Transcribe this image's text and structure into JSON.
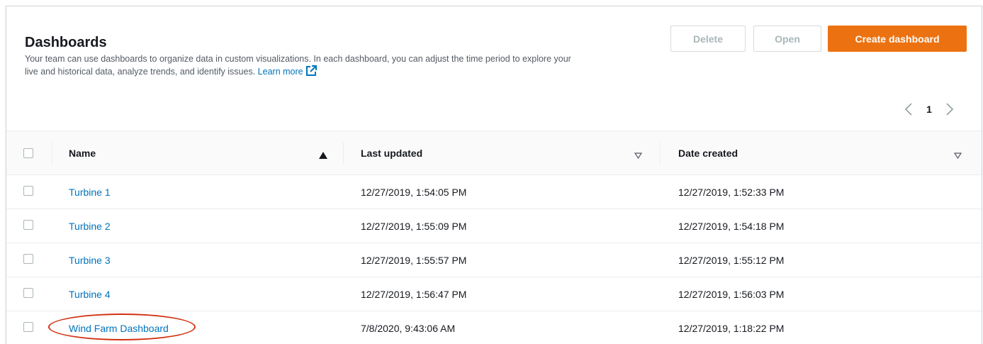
{
  "header": {
    "title": "Dashboards",
    "description": "Your team can use dashboards to organize data in custom visualizations. In each dashboard, you can adjust the time period to explore your live and historical data, analyze trends, and identify issues.",
    "learn_more_label": "Learn more",
    "buttons": {
      "delete_label": "Delete",
      "open_label": "Open",
      "create_label": "Create dashboard"
    }
  },
  "pagination": {
    "current_page": "1"
  },
  "table": {
    "columns": {
      "name": "Name",
      "last_updated": "Last updated",
      "date_created": "Date created"
    },
    "rows": [
      {
        "name": "Turbine 1",
        "last_updated": "12/27/2019, 1:54:05 PM",
        "date_created": "12/27/2019, 1:52:33 PM"
      },
      {
        "name": "Turbine 2",
        "last_updated": "12/27/2019, 1:55:09 PM",
        "date_created": "12/27/2019, 1:54:18 PM"
      },
      {
        "name": "Turbine 3",
        "last_updated": "12/27/2019, 1:55:57 PM",
        "date_created": "12/27/2019, 1:55:12 PM"
      },
      {
        "name": "Turbine 4",
        "last_updated": "12/27/2019, 1:56:47 PM",
        "date_created": "12/27/2019, 1:56:03 PM"
      },
      {
        "name": "Wind Farm Dashboard",
        "last_updated": "7/8/2020, 9:43:06 AM",
        "date_created": "12/27/2019, 1:18:22 PM"
      }
    ]
  },
  "colors": {
    "primary_button": "#ec7211",
    "link": "#0073bb",
    "highlight_oval": "#d13212"
  },
  "icons": {
    "external_link": "external-link-icon",
    "prev_page": "chevron-left-icon",
    "next_page": "chevron-right-icon",
    "sort_ascending": "caret-up-filled-icon",
    "sort_unsorted": "caret-down-outline-icon"
  }
}
